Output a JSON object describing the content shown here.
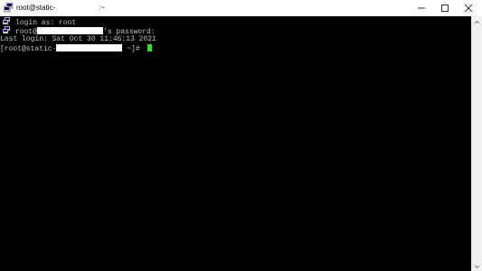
{
  "window": {
    "title_left": "root@static-",
    "title_right": ":~",
    "icon": "putty-icon",
    "controls": [
      "minimize-icon",
      "maximize-icon",
      "close-icon"
    ]
  },
  "terminal": {
    "lines": [
      {
        "text": "login as: root"
      },
      {
        "prefix": "root@",
        "suffix": "'s password:"
      },
      {
        "text": "Last login: Sat Oct 30 11:46:13 2021"
      },
      {
        "prefix": "[root@static-",
        "suffix": " ~]# "
      }
    ],
    "fg": "#c0c0c0",
    "bg": "#000000",
    "cursor_color": "#00ff00"
  }
}
